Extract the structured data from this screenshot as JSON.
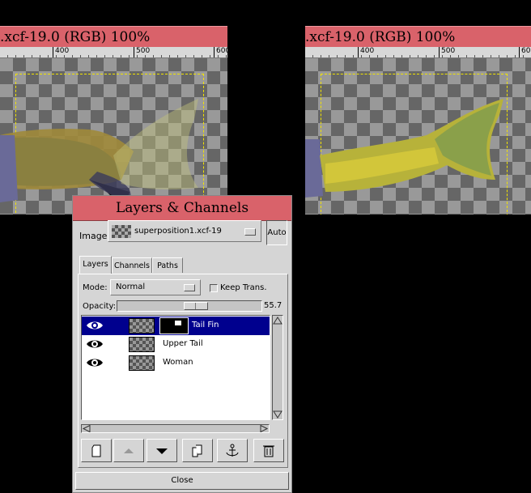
{
  "left_window": {
    "title": ".xcf-19.0 (RGB) 100%",
    "ruler_ticks": [
      "400",
      "500",
      "600"
    ]
  },
  "right_window": {
    "title": ".xcf-19.0 (RGB) 100%",
    "ruler_ticks": [
      "400",
      "500",
      "600"
    ]
  },
  "dialog": {
    "title": "Layers & Channels",
    "image_label": "Image:",
    "image_value": "superposition1.xcf-19",
    "auto_label": "Auto",
    "tabs": [
      {
        "label": "Layers",
        "active": true
      },
      {
        "label": "Channels",
        "active": false
      },
      {
        "label": "Paths",
        "active": false
      }
    ],
    "mode_label": "Mode:",
    "mode_value": "Normal",
    "keep_trans_label": "Keep Trans.",
    "keep_trans_checked": false,
    "opacity_label": "Opacity:",
    "opacity_value": "55.7",
    "layers": [
      {
        "name": "Tail Fin",
        "visible": true,
        "selected": true,
        "has_mask": true
      },
      {
        "name": "Upper Tail",
        "visible": true,
        "selected": false,
        "has_mask": false
      },
      {
        "name": "Woman",
        "visible": true,
        "selected": false,
        "has_mask": false
      }
    ],
    "toolbar": [
      "new-layer-icon",
      "raise-layer-icon",
      "lower-layer-icon",
      "duplicate-layer-icon",
      "anchor-icon",
      "delete-layer-icon"
    ],
    "close_label": "Close"
  }
}
